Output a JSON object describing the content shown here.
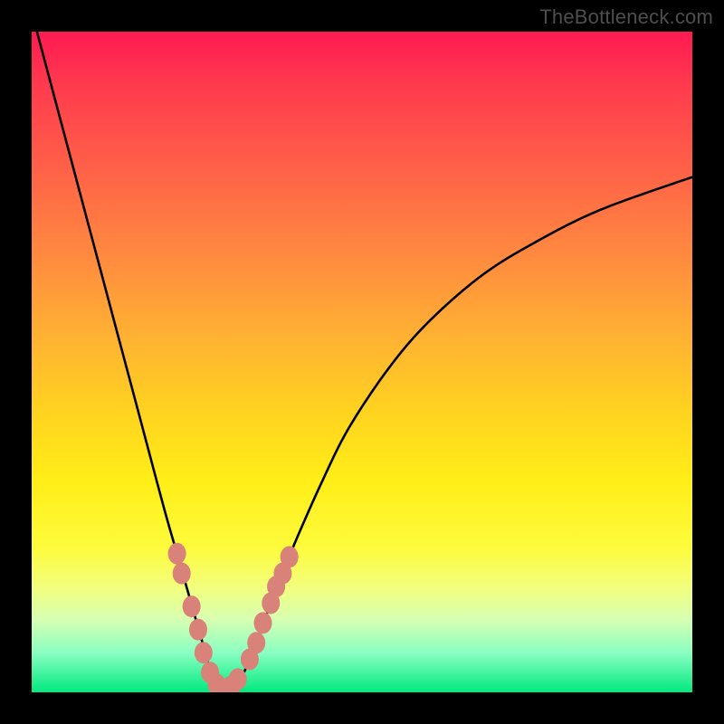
{
  "watermark": "TheBottleneck.com",
  "chart_data": {
    "type": "line",
    "title": "",
    "xlabel": "",
    "ylabel": "",
    "xlim": [
      0,
      100
    ],
    "ylim": [
      0,
      100
    ],
    "grid": false,
    "legend": false,
    "series": [
      {
        "name": "curve",
        "color": "#000000",
        "x": [
          0,
          4,
          8,
          12,
          16,
          20,
          22,
          24,
          26,
          27,
          28,
          29,
          30,
          32,
          34,
          36,
          38,
          40,
          44,
          48,
          54,
          60,
          68,
          76,
          86,
          100
        ],
        "y": [
          103,
          88,
          73,
          58,
          43,
          28,
          21,
          14,
          7,
          3.5,
          1.2,
          0.3,
          0.6,
          2.8,
          7.5,
          13,
          18,
          23,
          32,
          40,
          49,
          56,
          63,
          68,
          73,
          78
        ]
      },
      {
        "name": "markers",
        "color": "#d88279",
        "x": [
          22.0,
          22.7,
          24.2,
          25.2,
          26.0,
          27.0,
          28.0,
          29.0,
          30.2,
          31.2,
          33.0,
          34.0,
          35.0,
          36.2,
          37.0,
          38.0,
          39.0
        ],
        "y": [
          21.0,
          18.0,
          13.0,
          9.5,
          6.0,
          3.0,
          1.2,
          0.4,
          0.9,
          2.0,
          5.0,
          7.5,
          10.5,
          13.5,
          16.0,
          18.0,
          20.5
        ]
      }
    ]
  },
  "colors": {
    "background": "#000000",
    "curve": "#000000",
    "marker": "#d88279"
  }
}
